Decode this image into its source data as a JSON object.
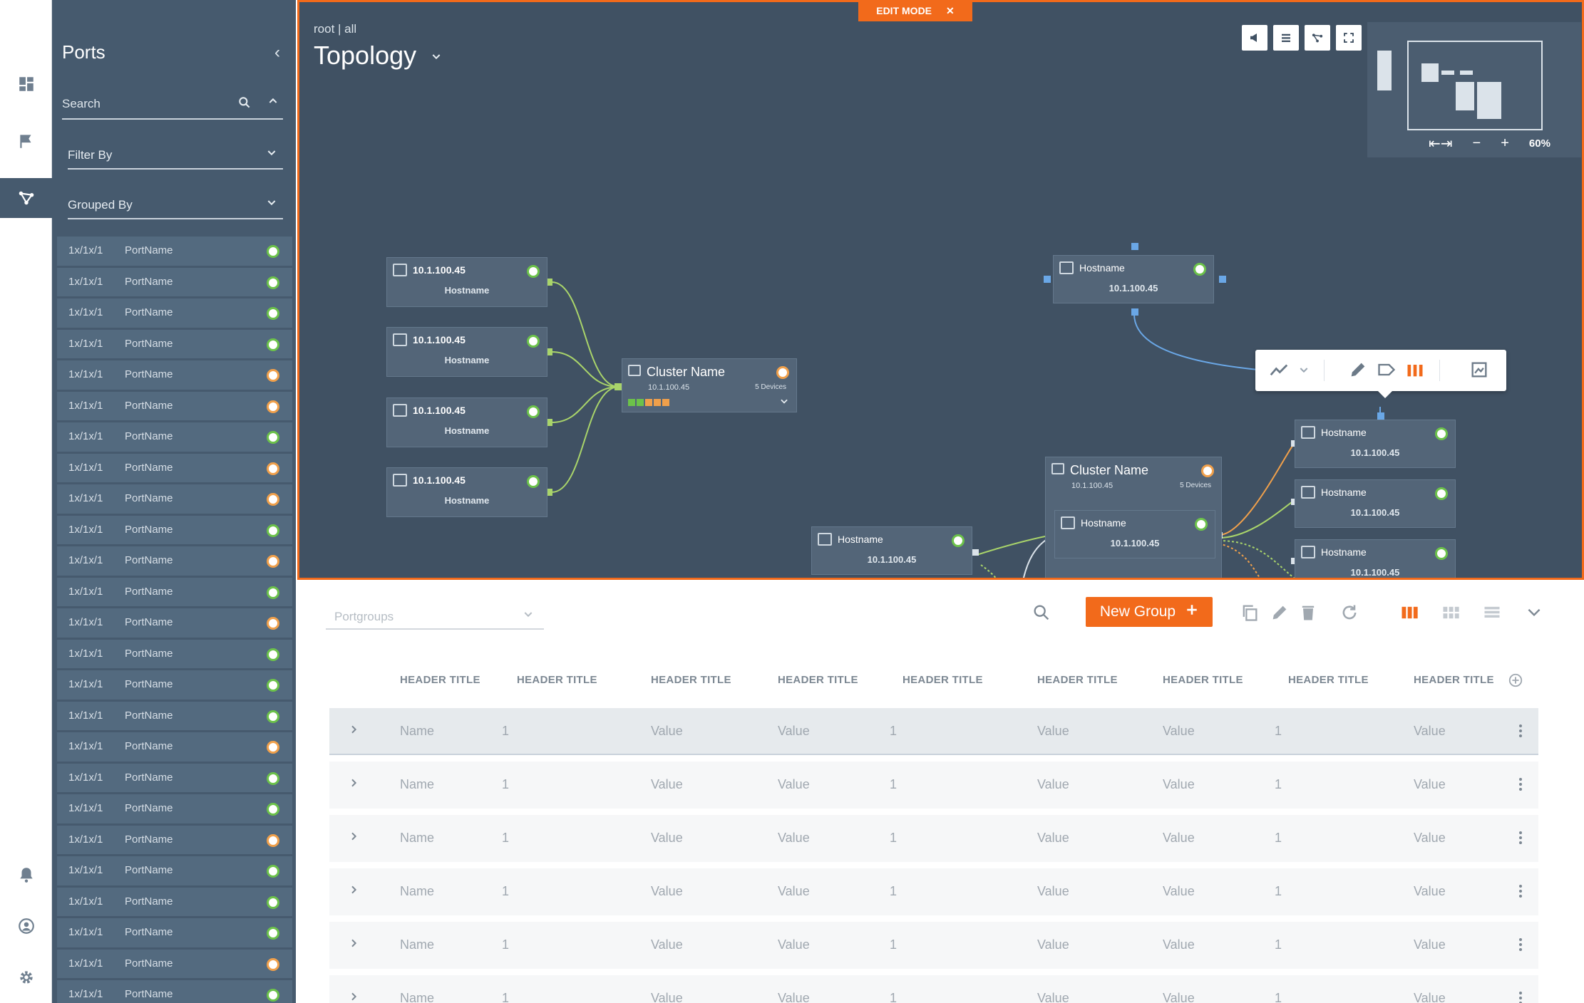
{
  "ports_panel": {
    "title": "Ports",
    "search_placeholder": "Search",
    "filter_label": "Filter By",
    "grouped_label": "Grouped By",
    "items": [
      {
        "id": "1x/1x/1",
        "name": "PortName",
        "status": "ok"
      },
      {
        "id": "1x/1x/1",
        "name": "PortName",
        "status": "ok"
      },
      {
        "id": "1x/1x/1",
        "name": "PortName",
        "status": "ok"
      },
      {
        "id": "1x/1x/1",
        "name": "PortName",
        "status": "ok"
      },
      {
        "id": "1x/1x/1",
        "name": "PortName",
        "status": "warn"
      },
      {
        "id": "1x/1x/1",
        "name": "PortName",
        "status": "warn"
      },
      {
        "id": "1x/1x/1",
        "name": "PortName",
        "status": "ok"
      },
      {
        "id": "1x/1x/1",
        "name": "PortName",
        "status": "warn"
      },
      {
        "id": "1x/1x/1",
        "name": "PortName",
        "status": "warn"
      },
      {
        "id": "1x/1x/1",
        "name": "PortName",
        "status": "ok"
      },
      {
        "id": "1x/1x/1",
        "name": "PortName",
        "status": "warn"
      },
      {
        "id": "1x/1x/1",
        "name": "PortName",
        "status": "ok"
      },
      {
        "id": "1x/1x/1",
        "name": "PortName",
        "status": "warn"
      },
      {
        "id": "1x/1x/1",
        "name": "PortName",
        "status": "ok"
      },
      {
        "id": "1x/1x/1",
        "name": "PortName",
        "status": "ok"
      },
      {
        "id": "1x/1x/1",
        "name": "PortName",
        "status": "ok"
      },
      {
        "id": "1x/1x/1",
        "name": "PortName",
        "status": "warn"
      },
      {
        "id": "1x/1x/1",
        "name": "PortName",
        "status": "ok"
      },
      {
        "id": "1x/1x/1",
        "name": "PortName",
        "status": "ok"
      },
      {
        "id": "1x/1x/1",
        "name": "PortName",
        "status": "warn"
      },
      {
        "id": "1x/1x/1",
        "name": "PortName",
        "status": "ok"
      },
      {
        "id": "1x/1x/1",
        "name": "PortName",
        "status": "ok"
      },
      {
        "id": "1x/1x/1",
        "name": "PortName",
        "status": "ok"
      },
      {
        "id": "1x/1x/1",
        "name": "PortName",
        "status": "warn"
      },
      {
        "id": "1x/1x/1",
        "name": "PortName",
        "status": "ok"
      }
    ]
  },
  "topology": {
    "edit_mode_label": "EDIT MODE",
    "breadcrumb": "root | all",
    "title": "Topology",
    "minimap_zoom": "60%",
    "left_nodes": [
      {
        "ip": "10.1.100.45",
        "hostname": "Hostname"
      },
      {
        "ip": "10.1.100.45",
        "hostname": "Hostname"
      },
      {
        "ip": "10.1.100.45",
        "hostname": "Hostname"
      },
      {
        "ip": "10.1.100.45",
        "hostname": "Hostname"
      }
    ],
    "cluster_left": {
      "name": "Cluster Name",
      "ip": "10.1.100.45",
      "devices": "5 Devices"
    },
    "cluster_right": {
      "name": "Cluster Name",
      "ip": "10.1.100.45",
      "devices": "5 Devices"
    },
    "node_top": {
      "hostname": "Hostname",
      "ip": "10.1.100.45"
    },
    "node_mid": {
      "hostname": "Hostname",
      "ip": "10.1.100.45"
    },
    "node_cluster_inner": {
      "hostname": "Hostname",
      "ip": "10.1.100.45"
    },
    "right_nodes": [
      {
        "hostname": "Hostname",
        "ip": "10.1.100.45"
      },
      {
        "hostname": "Hostname",
        "ip": "10.1.100.45"
      },
      {
        "hostname": "Hostname",
        "ip": "10.1.100.45"
      }
    ]
  },
  "toolbar": {
    "portgroups_placeholder": "Portgroups",
    "new_group_label": "New Group"
  },
  "table": {
    "headers": [
      "HEADER TITLE",
      "HEADER TITLE",
      "HEADER TITLE",
      "HEADER TITLE",
      "HEADER TITLE",
      "HEADER TITLE",
      "HEADER TITLE",
      "HEADER TITLE",
      "HEADER TITLE"
    ],
    "rows": [
      [
        "Name",
        "1",
        "Value",
        "Value",
        "1",
        "Value",
        "Value",
        "1",
        "Value"
      ],
      [
        "Name",
        "1",
        "Value",
        "Value",
        "1",
        "Value",
        "Value",
        "1",
        "Value"
      ],
      [
        "Name",
        "1",
        "Value",
        "Value",
        "1",
        "Value",
        "Value",
        "1",
        "Value"
      ],
      [
        "Name",
        "1",
        "Value",
        "Value",
        "1",
        "Value",
        "Value",
        "1",
        "Value"
      ],
      [
        "Name",
        "1",
        "Value",
        "Value",
        "1",
        "Value",
        "Value",
        "1",
        "Value"
      ],
      [
        "Name",
        "1",
        "Value",
        "Value",
        "1",
        "Value",
        "Value",
        "1",
        "Value"
      ]
    ]
  },
  "colors": {
    "accent": "#f26a1b",
    "ok": "#6cc24a",
    "warn": "#f0a04b",
    "panel": "#465a6e",
    "canvas": "#405163"
  }
}
